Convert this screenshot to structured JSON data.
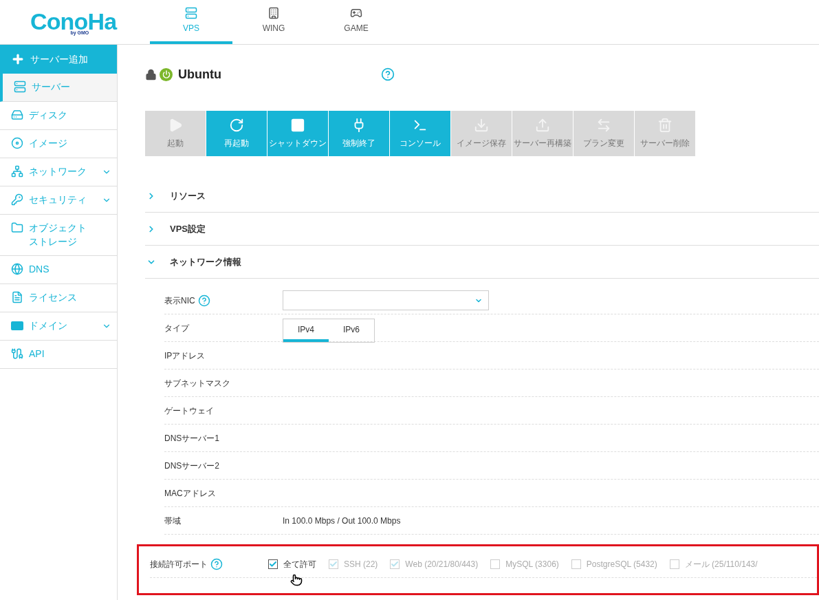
{
  "logo": {
    "text": "ConoHa",
    "sub": "by GMO"
  },
  "top_tabs": [
    {
      "label": "VPS",
      "selected": true
    },
    {
      "label": "WING",
      "selected": false
    },
    {
      "label": "GAME",
      "selected": false
    }
  ],
  "add_button": {
    "label": "サーバー追加"
  },
  "sidebar": {
    "items": [
      {
        "label": "サーバー",
        "selected": true,
        "expandable": false
      },
      {
        "label": "ディスク",
        "selected": false,
        "expandable": false
      },
      {
        "label": "イメージ",
        "selected": false,
        "expandable": false
      },
      {
        "label": "ネットワーク",
        "selected": false,
        "expandable": true
      },
      {
        "label": "セキュリティ",
        "selected": false,
        "expandable": true
      },
      {
        "label": "オブジェクトストレージ",
        "selected": false,
        "expandable": false
      },
      {
        "label": "DNS",
        "selected": false,
        "expandable": false
      },
      {
        "label": "ライセンス",
        "selected": false,
        "expandable": false
      },
      {
        "label": "ドメイン",
        "selected": false,
        "expandable": true
      },
      {
        "label": "API",
        "selected": false,
        "expandable": false
      }
    ]
  },
  "server": {
    "name": "Ubuntu",
    "locked": true,
    "running": true
  },
  "actions": [
    {
      "label": "起動",
      "disabled": true
    },
    {
      "label": "再起動",
      "disabled": false
    },
    {
      "label": "シャットダウン",
      "disabled": false
    },
    {
      "label": "強制終了",
      "disabled": false
    },
    {
      "label": "コンソール",
      "disabled": false
    },
    {
      "label": "イメージ保存",
      "disabled": true
    },
    {
      "label": "サーバー再構築",
      "disabled": true
    },
    {
      "label": "プラン変更",
      "disabled": true
    },
    {
      "label": "サーバー削除",
      "disabled": true
    }
  ],
  "sections": [
    {
      "title": "リソース",
      "expanded": false
    },
    {
      "title": "VPS設定",
      "expanded": false
    },
    {
      "title": "ネットワーク情報",
      "expanded": true
    }
  ],
  "network": {
    "rows": [
      {
        "kind": "select",
        "label": "表示NIC",
        "help": true
      },
      {
        "kind": "tabs",
        "label": "タイプ",
        "tabs": [
          {
            "label": "IPv4",
            "selected": true
          },
          {
            "label": "IPv6",
            "selected": false
          }
        ]
      },
      {
        "kind": "text",
        "label": "IPアドレス"
      },
      {
        "kind": "text",
        "label": "サブネットマスク"
      },
      {
        "kind": "text",
        "label": "ゲートウェイ"
      },
      {
        "kind": "text",
        "label": "DNSサーバー1"
      },
      {
        "kind": "text",
        "label": "DNSサーバー2"
      },
      {
        "kind": "text",
        "label": "MACアドレス"
      },
      {
        "kind": "text",
        "label": "帯域",
        "value": "In 100.0 Mbps / Out 100.0 Mbps"
      },
      {
        "kind": "ports",
        "label": "接続許可ポート",
        "help": true,
        "highlighted": true,
        "ports": [
          {
            "label": "全て許可",
            "checked": true,
            "disabled": false
          },
          {
            "label": "SSH (22)",
            "checked": true,
            "disabled": true
          },
          {
            "label": "Web (20/21/80/443)",
            "checked": true,
            "disabled": true
          },
          {
            "label": "MySQL (3306)",
            "checked": false,
            "disabled": true
          },
          {
            "label": "PostgreSQL (5432)",
            "checked": false,
            "disabled": true
          },
          {
            "label": "メール (25/110/143/",
            "checked": false,
            "disabled": true
          }
        ]
      }
    ]
  }
}
